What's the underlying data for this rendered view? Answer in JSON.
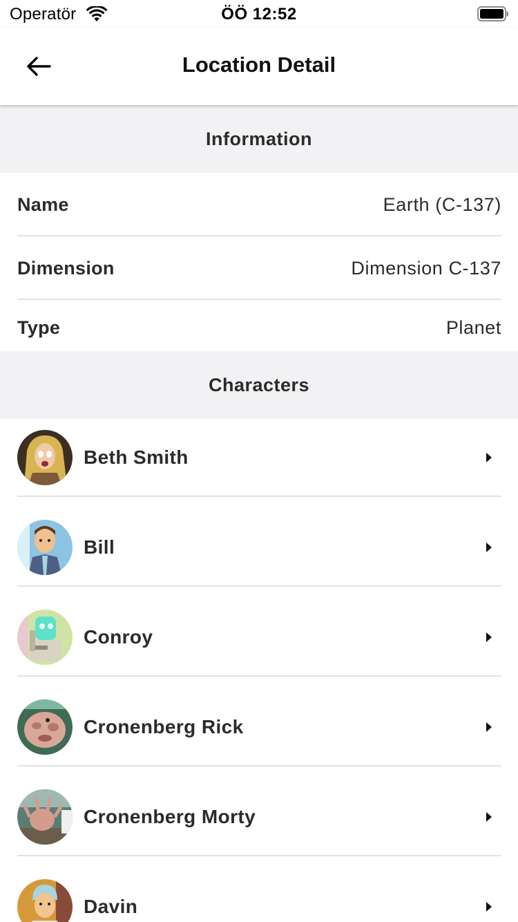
{
  "status_bar": {
    "carrier": "Operatör",
    "time": "ÖÖ 12:52",
    "wifi_icon": "wifi-icon",
    "battery_icon": "battery-full-icon"
  },
  "nav": {
    "title": "Location Detail",
    "back_icon": "arrow-left-icon"
  },
  "information": {
    "header": "Information",
    "rows": [
      {
        "label": "Name",
        "value": "Earth (C-137)"
      },
      {
        "label": "Dimension",
        "value": "Dimension C-137"
      },
      {
        "label": "Type",
        "value": "Planet"
      }
    ]
  },
  "characters": {
    "header": "Characters",
    "items": [
      {
        "name": "Beth Smith",
        "avatar": "beth-smith-avatar"
      },
      {
        "name": "Bill",
        "avatar": "bill-avatar"
      },
      {
        "name": "Conroy",
        "avatar": "conroy-avatar"
      },
      {
        "name": "Cronenberg Rick",
        "avatar": "cronenberg-rick-avatar"
      },
      {
        "name": "Cronenberg Morty",
        "avatar": "cronenberg-morty-avatar"
      },
      {
        "name": "Davin",
        "avatar": "davin-avatar"
      }
    ],
    "chevron_icon": "chevron-right-icon"
  },
  "colors": {
    "section_bg": "#f2f1f4",
    "divider": "#e3e3e3",
    "text": "#2b2b2b"
  }
}
